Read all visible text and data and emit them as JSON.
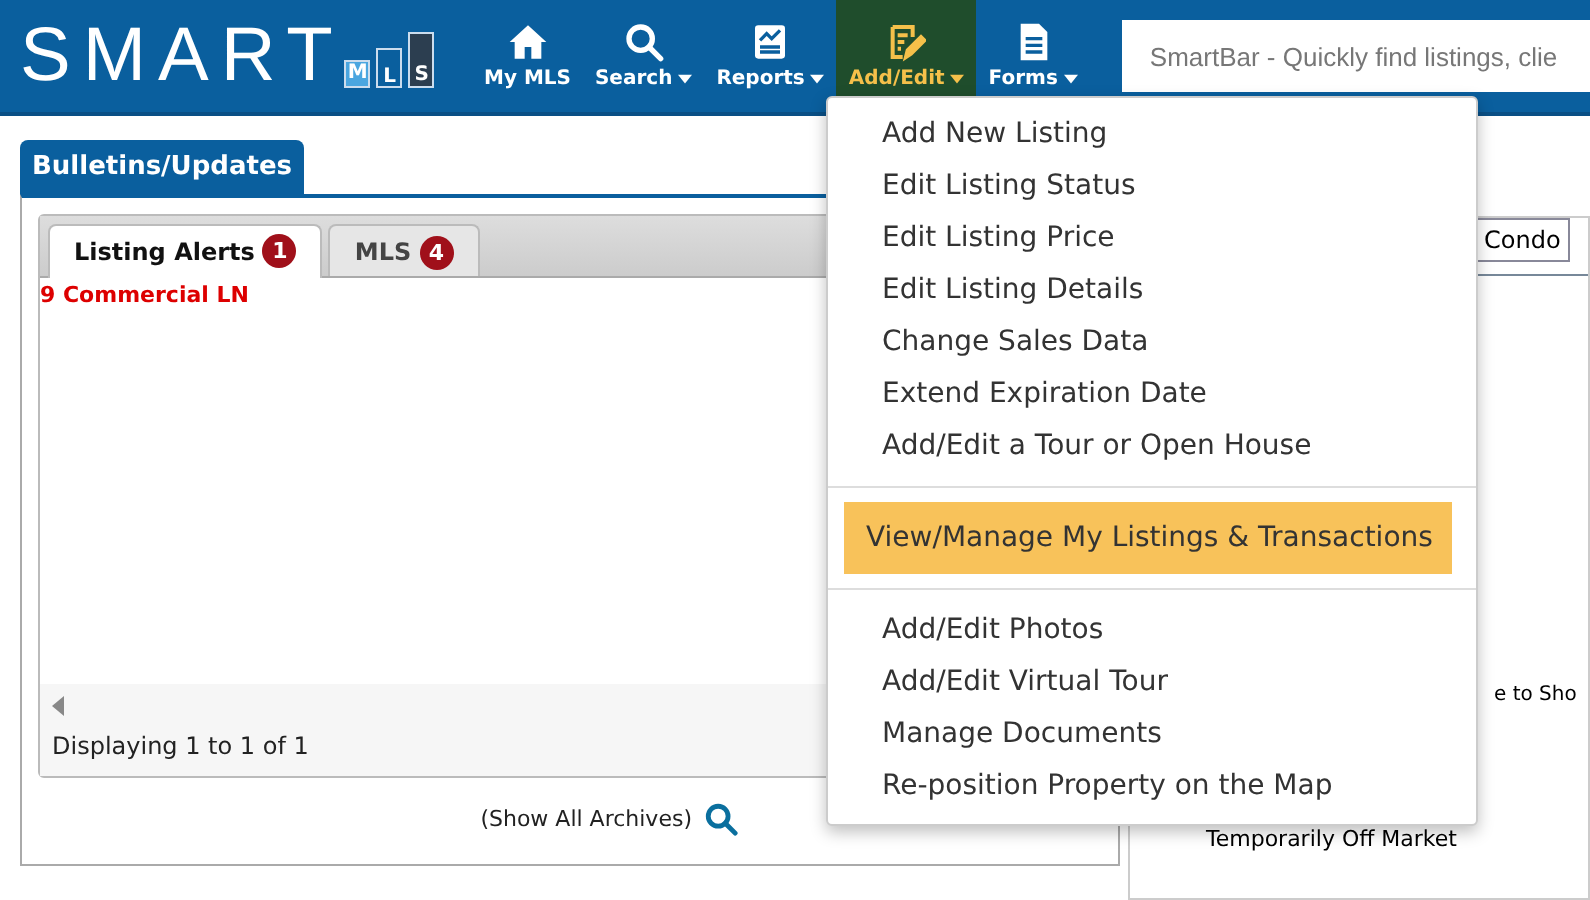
{
  "header": {
    "logo": {
      "word": "SMART",
      "letters": [
        "M",
        "L",
        "S"
      ]
    },
    "nav": [
      {
        "label": "My MLS",
        "dropdown": false,
        "selected": false
      },
      {
        "label": "Search",
        "dropdown": true,
        "selected": false
      },
      {
        "label": "Reports",
        "dropdown": true,
        "selected": false
      },
      {
        "label": "Add/Edit",
        "dropdown": true,
        "selected": true
      },
      {
        "label": "Forms",
        "dropdown": true,
        "selected": false
      }
    ],
    "smartbar": {
      "placeholder": "SmartBar - Quickly find listings, clie"
    }
  },
  "bulletins": {
    "title": "Bulletins/Updates",
    "tabs": [
      {
        "label": "Listing Alerts",
        "badge": "1",
        "selected": true
      },
      {
        "label": "MLS",
        "badge": "4",
        "selected": false
      }
    ],
    "alerts": [
      "9 Commercial LN"
    ],
    "paging": "Displaying 1 to 1 of 1",
    "archives_link": "(Show All Archives)"
  },
  "right_panel": {
    "field": "Condo",
    "text_fragment": "e to Sho",
    "status": "Temporarily Off Market"
  },
  "menu": {
    "groups": [
      [
        {
          "label": "Add New Listing",
          "selected": false
        },
        {
          "label": "Edit Listing Status",
          "selected": false
        },
        {
          "label": "Edit Listing Price",
          "selected": false
        },
        {
          "label": "Edit Listing Details",
          "selected": false
        },
        {
          "label": "Change Sales Data",
          "selected": false
        },
        {
          "label": "Extend Expiration Date",
          "selected": false
        },
        {
          "label": "Add/Edit a Tour or Open House",
          "selected": false
        }
      ],
      [
        {
          "label": "View/Manage My Listings & Transactions",
          "selected": true
        }
      ],
      [
        {
          "label": "Add/Edit Photos",
          "selected": false
        },
        {
          "label": "Add/Edit Virtual Tour",
          "selected": false
        },
        {
          "label": "Manage Documents",
          "selected": false
        },
        {
          "label": "Re-position Property on the Map",
          "selected": false
        }
      ]
    ]
  }
}
